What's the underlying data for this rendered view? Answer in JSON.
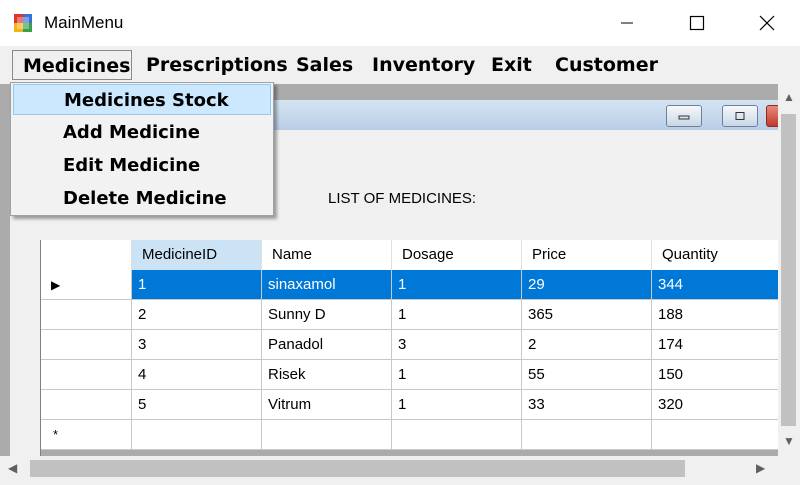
{
  "window": {
    "title": "MainMenu"
  },
  "menu": {
    "items": [
      {
        "label": "Medicines"
      },
      {
        "label": "Prescriptions"
      },
      {
        "label": "Sales"
      },
      {
        "label": "Inventory"
      },
      {
        "label": "Exit"
      },
      {
        "label": "Customer"
      }
    ],
    "dropdown": [
      {
        "label": "Medicines Stock"
      },
      {
        "label": "Add Medicine"
      },
      {
        "label": "Edit Medicine"
      },
      {
        "label": "Delete Medicine"
      }
    ]
  },
  "form": {
    "caption": "LIST OF MEDICINES:"
  },
  "grid": {
    "columns": [
      "MedicineID",
      "Name",
      "Dosage",
      "Price",
      "Quantity"
    ],
    "rows": [
      [
        "1",
        "sinaxamol",
        "1",
        "29",
        "344"
      ],
      [
        "2",
        "Sunny D",
        "1",
        "365",
        "188"
      ],
      [
        "3",
        "Panadol",
        "3",
        "2",
        "174"
      ],
      [
        "4",
        "Risek",
        "1",
        "55",
        "150"
      ],
      [
        "5",
        "Vitrum",
        "1",
        "33",
        "320"
      ]
    ],
    "current_row_marker": "▶",
    "new_row_marker": "*"
  },
  "colors": {
    "selection": "#0078d7",
    "header_selected": "#cce3f5",
    "menu_highlight": "#cce8ff"
  },
  "icons": [
    "app-icon",
    "minimize-icon",
    "maximize-icon",
    "close-icon"
  ]
}
